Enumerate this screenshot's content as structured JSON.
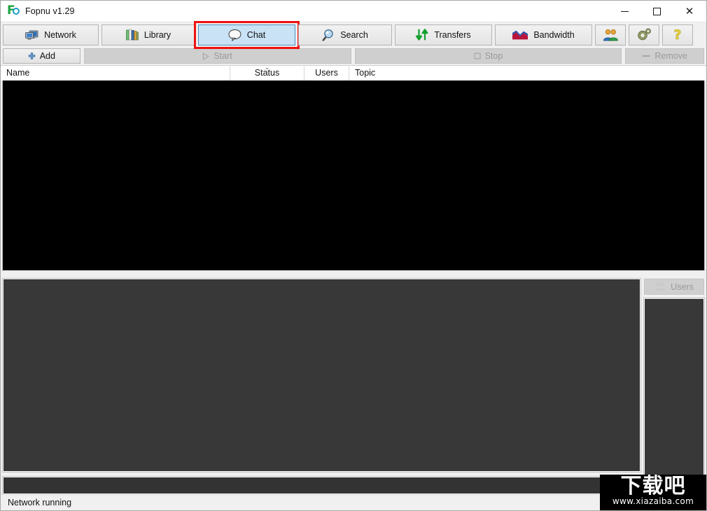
{
  "window": {
    "title": "Fopnu v1.29",
    "logo_icon": "fopnu-logo-icon",
    "controls": {
      "minimize": "minimize-icon",
      "maximize": "maximize-icon",
      "close": "close-icon"
    }
  },
  "toolbar": {
    "tabs": [
      {
        "label": "Network",
        "icon": "network-computers-icon",
        "active": false
      },
      {
        "label": "Library",
        "icon": "books-icon",
        "active": false
      },
      {
        "label": "Chat",
        "icon": "speech-bubble-icon",
        "active": true
      },
      {
        "label": "Search",
        "icon": "magnifier-icon",
        "active": false
      },
      {
        "label": "Transfers",
        "icon": "up-down-arrows-icon",
        "active": false
      },
      {
        "label": "Bandwidth",
        "icon": "wave-chart-icon",
        "active": false
      }
    ],
    "icon_buttons": [
      {
        "name": "people-icon",
        "label": ""
      },
      {
        "name": "gear-icon",
        "label": ""
      },
      {
        "name": "question-icon",
        "label": ""
      }
    ],
    "annotation": {
      "target": "Chat",
      "color": "#ee1111"
    }
  },
  "actionbar": {
    "add": {
      "label": "Add",
      "icon": "plus-icon",
      "enabled": true
    },
    "start": {
      "label": "Start",
      "icon": "play-icon",
      "enabled": false
    },
    "stop": {
      "label": "Stop",
      "icon": "square-icon",
      "enabled": false
    },
    "remove": {
      "label": "Remove",
      "icon": "minus-icon",
      "enabled": false
    }
  },
  "channel_table": {
    "columns": [
      {
        "label": "Name",
        "sorted": false
      },
      {
        "label": "Status",
        "sorted": true,
        "sort_icon": "chevron-down-icon"
      },
      {
        "label": "Users",
        "sorted": false
      },
      {
        "label": "Topic",
        "sorted": false
      }
    ],
    "rows": []
  },
  "chat": {
    "messages": [],
    "input_value": "",
    "users_button": {
      "label": "Users",
      "icon": "people-icon",
      "enabled": false
    },
    "users": []
  },
  "statusbar": {
    "text": "Network running"
  },
  "watermark": {
    "cn": "下载吧",
    "url": "www.xiazaiba.com"
  },
  "colors": {
    "accent": "#c9e2f5",
    "accent_border": "#4a90c2",
    "annotation": "#ee1111",
    "panel_dark": "#383838",
    "list_black": "#000000",
    "chrome": "#f0f0f0"
  }
}
